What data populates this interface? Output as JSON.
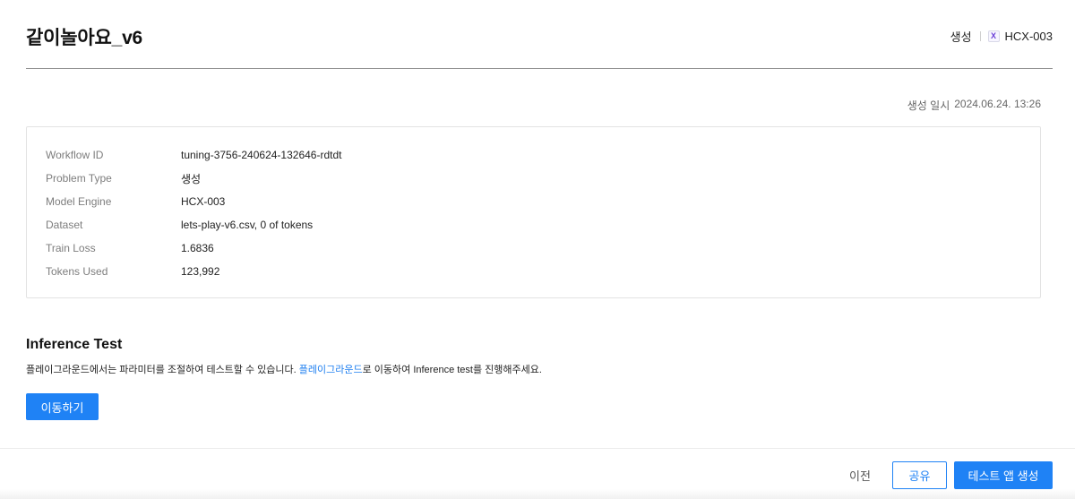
{
  "header": {
    "title": "같이놀아요_v6",
    "task_type": "생성",
    "engine_icon_glyph": "X",
    "engine_icon": "hyperclova-x-icon",
    "engine": "HCX-003"
  },
  "created_at": {
    "label": "생성 일시",
    "value": "2024.06.24. 13:26"
  },
  "info": {
    "rows": [
      {
        "label": "Workflow ID",
        "value": "tuning-3756-240624-132646-rdtdt"
      },
      {
        "label": "Problem Type",
        "value": "생성"
      },
      {
        "label": "Model Engine",
        "value": "HCX-003"
      },
      {
        "label": "Dataset",
        "value": "lets-play-v6.csv, 0 of tokens"
      },
      {
        "label": "Train Loss",
        "value": "1.6836"
      },
      {
        "label": "Tokens Used",
        "value": "123,992"
      }
    ]
  },
  "inference": {
    "title": "Inference Test",
    "desc_before": "플레이그라운드에서는 파라미터를 조절하여 테스트할 수 있습니다. ",
    "desc_link": "플레이그라운드",
    "desc_after": "로 이동하여 Inference test를 진행해주세요.",
    "button_label": "이동하기"
  },
  "footer": {
    "prev_label": "이전",
    "share_label": "공유",
    "create_app_label": "테스트 앱 생성"
  },
  "colors": {
    "accent": "#1f82f5",
    "link": "#1f7ff0",
    "engine_icon": "#6a3fd6"
  }
}
